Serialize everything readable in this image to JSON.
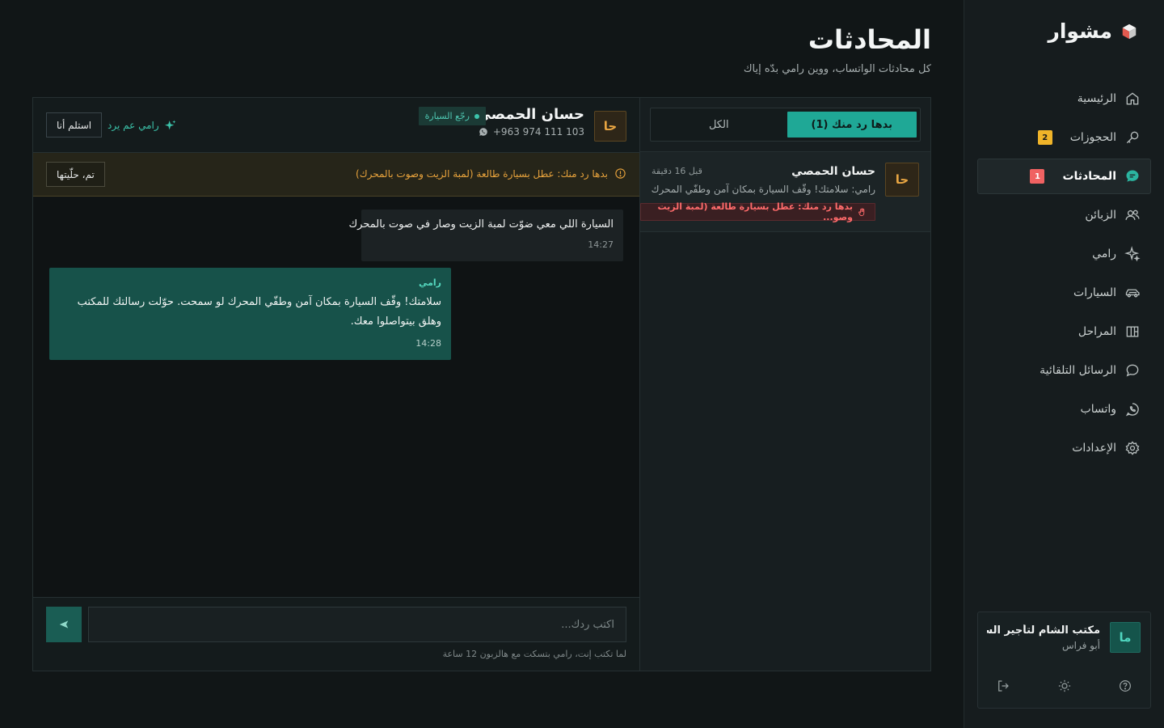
{
  "app": {
    "name": "مشوار",
    "accent": "#1fa896"
  },
  "sidebar": {
    "items": [
      {
        "label": "الرئيسية",
        "icon": "home-icon",
        "badge": null,
        "active": false
      },
      {
        "label": "الحجوزات",
        "icon": "key-icon",
        "badge": "2",
        "active": false
      },
      {
        "label": "المحادثات",
        "icon": "chat-icon",
        "badge": "1",
        "active": true
      },
      {
        "label": "الزبائن",
        "icon": "users-icon",
        "badge": null,
        "active": false
      },
      {
        "label": "رامي",
        "icon": "sparkle-icon",
        "badge": null,
        "active": false
      },
      {
        "label": "السيارات",
        "icon": "car-icon",
        "badge": null,
        "active": false
      },
      {
        "label": "المراحل",
        "icon": "board-icon",
        "badge": null,
        "active": false
      },
      {
        "label": "الرسائل التلقائية",
        "icon": "message-icon",
        "badge": null,
        "active": false
      },
      {
        "label": "واتساب",
        "icon": "whatsapp-icon",
        "badge": null,
        "active": false
      },
      {
        "label": "الإعدادات",
        "icon": "gear-icon",
        "badge": null,
        "active": false
      }
    ],
    "workspace": {
      "avatar": "ما",
      "name": "مكتب الشام لتأجير السيارات",
      "owner": "أبو فراس"
    }
  },
  "header": {
    "title": "المحادثات",
    "subtitle": "كل محادثات الواتساب، ووين رامي بدّه إياك"
  },
  "conversations": {
    "tabs": [
      {
        "label": "بدها رد منك (1)",
        "active": true
      },
      {
        "label": "الكل",
        "active": false
      }
    ],
    "items": [
      {
        "avatar": "حا",
        "name": "حسان الحمصي",
        "time": "قبل 16 دقيقة",
        "preview_sender": "رامي:",
        "preview_text": "سلامتك! وقّف السيارة بمكان آمن وطفّي المحرك لـ...",
        "alert": "بدها رد منك: عطل بسيارة طالعة (لمبة الزيت وصو..."
      }
    ]
  },
  "chat": {
    "avatar": "حا",
    "name": "حسان الحمصي",
    "tag": "رجّع السيارة",
    "phone": "+963 974 111 103",
    "ai_status": "رامي عم يرد",
    "takeover_label": "استلم أنا",
    "alert_text": "بدها رد منك: عطل بسيارة طالعة (لمبة الزيت وصوت بالمحرك)",
    "resolve_label": "تم، حلّيتها",
    "messages": {
      "incoming": {
        "text": "السيارة اللي معي ضوّت لمبة الزيت وصار في صوت بالمحرك",
        "time": "14:27"
      },
      "outgoing": {
        "sender": "رامي",
        "text": "سلامتك! وقّف السيارة بمكان آمن وطفّي المحرك لو سمحت. حوّلت رسالتك للمكتب وهلق بيتواصلوا معك.",
        "time": "14:28"
      }
    },
    "composer": {
      "placeholder": "اكتب ردك...",
      "hint": "لما تكتب إنت، رامي بتسكت مع هالزبون 12 ساعة"
    }
  }
}
